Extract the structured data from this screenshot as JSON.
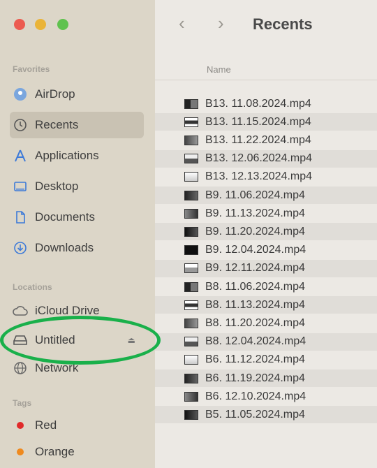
{
  "sidebar": {
    "favorites_title": "Favorites",
    "favorites": [
      {
        "label": "AirDrop",
        "icon": "airdrop-icon"
      },
      {
        "label": "Recents",
        "icon": "clock-icon",
        "selected": true
      },
      {
        "label": "Applications",
        "icon": "applications-icon"
      },
      {
        "label": "Desktop",
        "icon": "desktop-icon"
      },
      {
        "label": "Documents",
        "icon": "document-icon"
      },
      {
        "label": "Downloads",
        "icon": "download-icon"
      }
    ],
    "locations_title": "Locations",
    "locations": [
      {
        "label": "iCloud Drive",
        "icon": "cloud-icon"
      },
      {
        "label": "Untitled",
        "icon": "drive-icon",
        "ejectable": true
      },
      {
        "label": "Network",
        "icon": "globe-icon"
      }
    ],
    "tags_title": "Tags",
    "tags": [
      {
        "label": "Red",
        "color": "#e02a2a"
      },
      {
        "label": "Orange",
        "color": "#ef8a1f"
      }
    ]
  },
  "toolbar": {
    "back": "‹",
    "forward": "›",
    "title": "Recents"
  },
  "list": {
    "column_name": "Name",
    "files": [
      "B13. 11.08.2024.mp4",
      "B13. 11.15.2024.mp4",
      "B13. 11.22.2024.mp4",
      "B13. 12.06.2024.mp4",
      "B13. 12.13.2024.mp4",
      "B9. 11.06.2024.mp4",
      "B9. 11.13.2024.mp4",
      "B9. 11.20.2024.mp4",
      "B9. 12.04.2024.mp4",
      "B9. 12.11.2024.mp4",
      "B8. 11.06.2024.mp4",
      "B8. 11.13.2024.mp4",
      "B8. 11.20.2024.mp4",
      "B8. 12.04.2024.mp4",
      "B6. 11.12.2024.mp4",
      "B6. 11.19.2024.mp4",
      "B6. 12.10.2024.mp4",
      "B5. 11.05.2024.mp4"
    ]
  },
  "colors": {
    "annotation": "#19b04a",
    "sidebar_bg": "#dcd6c8",
    "selected_bg": "#c9c2b3"
  }
}
